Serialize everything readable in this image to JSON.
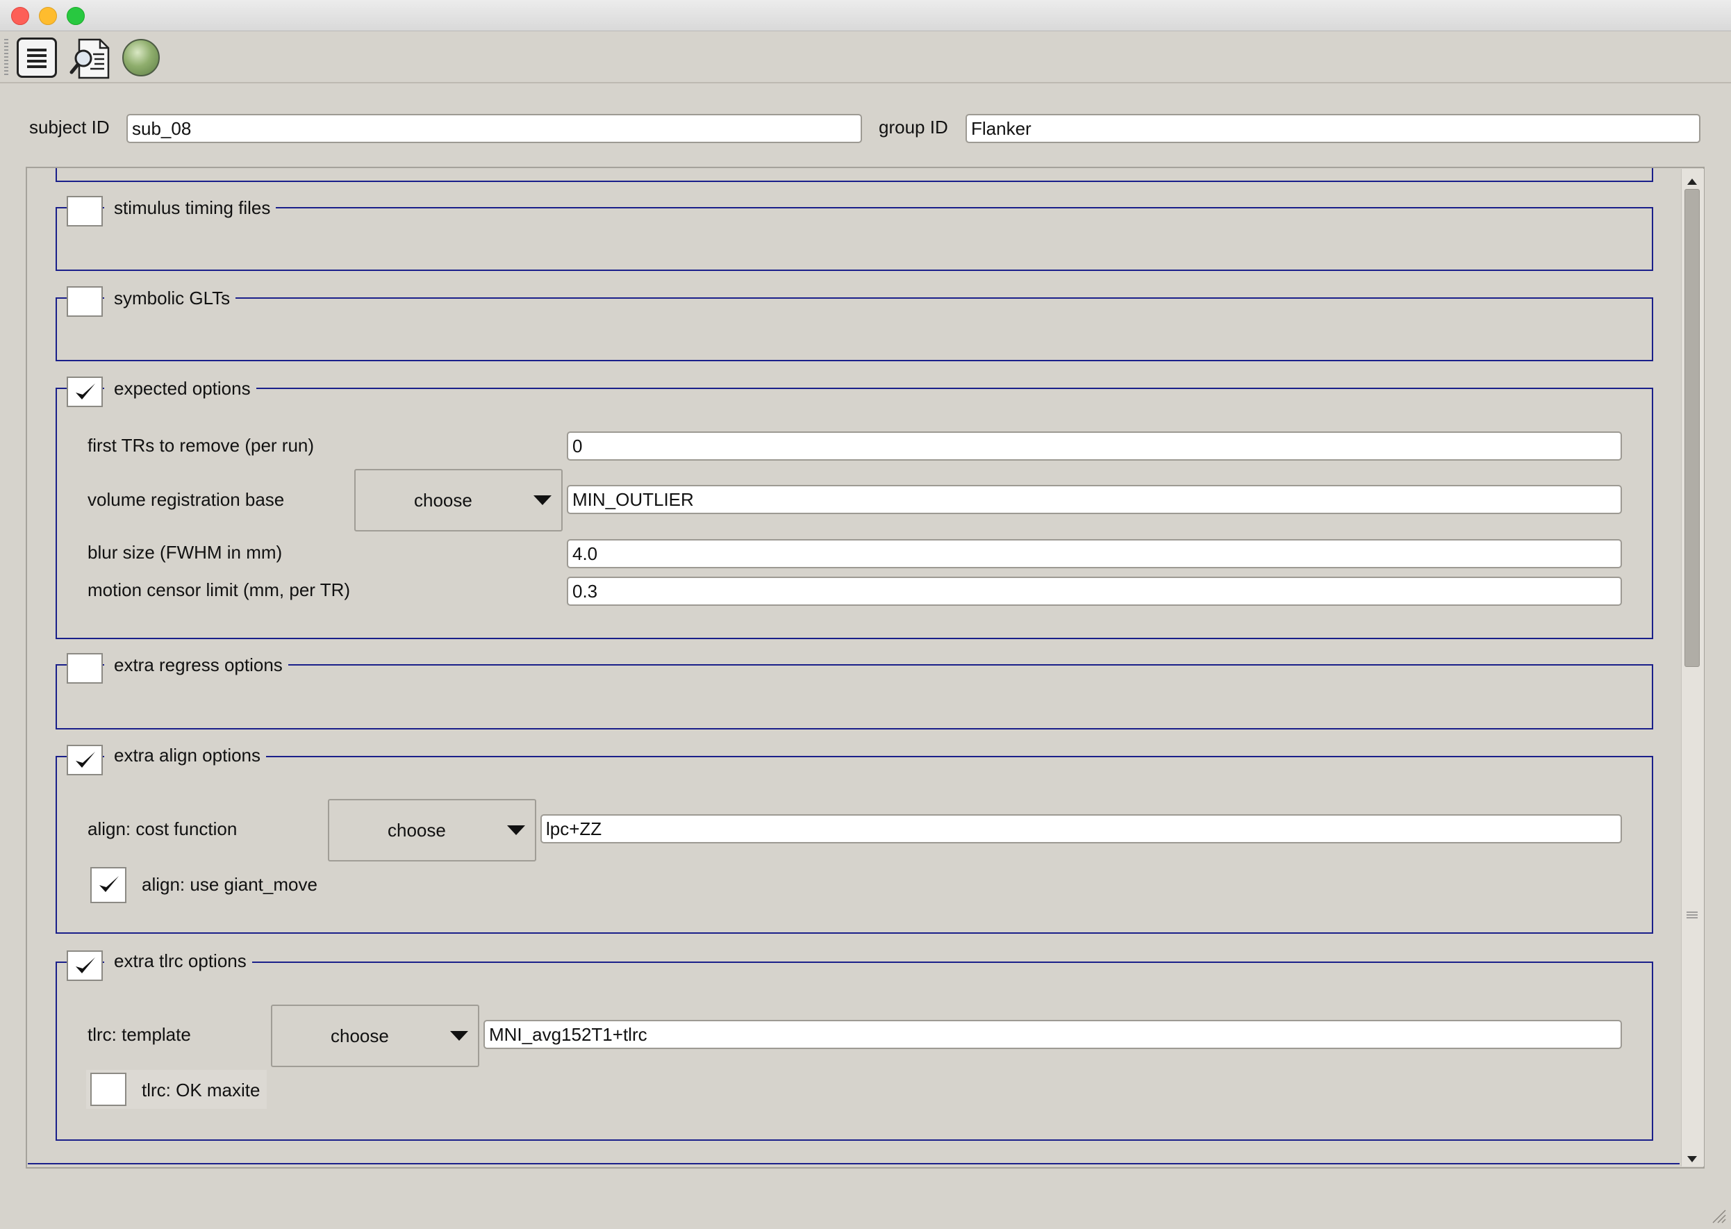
{
  "header": {
    "subject_label": "subject ID",
    "subject_value": "sub_08",
    "group_label": "group ID",
    "group_value": "Flanker"
  },
  "toolbar": {
    "icons": [
      "list-icon",
      "search-document-icon",
      "go-icon"
    ]
  },
  "sections": {
    "stimulus": {
      "title": "stimulus timing files",
      "checked": false
    },
    "glts": {
      "title": "symbolic GLTs",
      "checked": false
    },
    "expected": {
      "title": "expected options",
      "checked": true,
      "first_trs_label": "first TRs to remove (per run)",
      "first_trs_value": "0",
      "volreg_label": "volume registration base",
      "volreg_button": "choose",
      "volreg_value": "MIN_OUTLIER",
      "blur_label": "blur size (FWHM in mm)",
      "blur_value": "4.0",
      "motion_label": "motion censor limit (mm, per TR)",
      "motion_value": "0.3"
    },
    "regress": {
      "title": "extra regress options",
      "checked": false
    },
    "align": {
      "title": "extra align options",
      "checked": true,
      "cost_label": "align: cost function",
      "cost_button": "choose",
      "cost_value": "lpc+ZZ",
      "giant_label": "align: use giant_move",
      "giant_checked": true
    },
    "tlrc": {
      "title": "extra tlrc options",
      "checked": true,
      "template_label": "tlrc: template",
      "template_button": "choose",
      "template_value": "MNI_avg152T1+tlrc",
      "maxite_label": "tlrc: OK maxite",
      "maxite_checked": false
    }
  },
  "colors": {
    "background": "#d6d3cc",
    "group_border": "#1a1f8a"
  }
}
